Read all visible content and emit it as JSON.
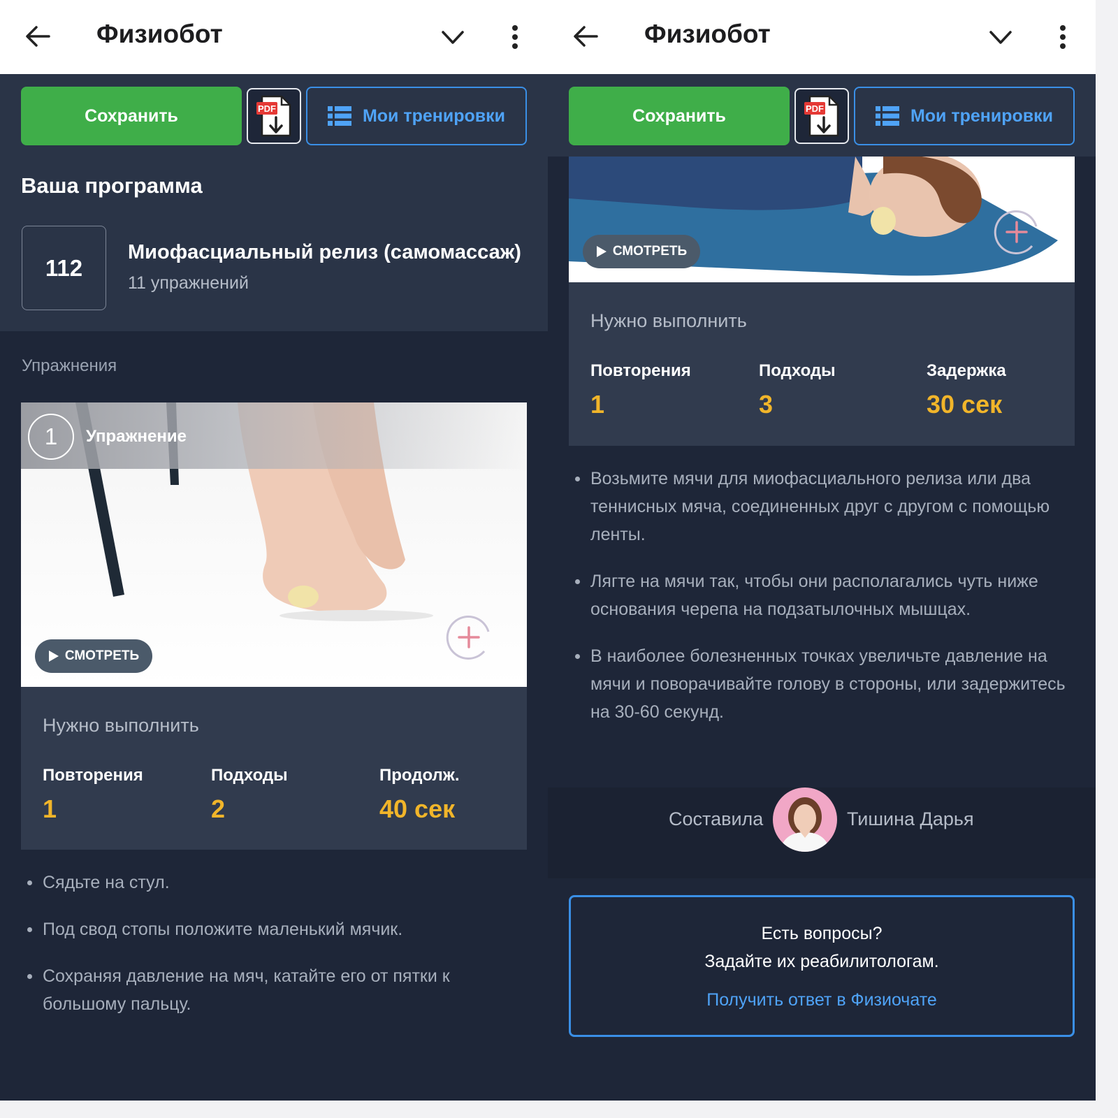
{
  "app": {
    "title": "Физиобот"
  },
  "toolbar": {
    "save_label": "Сохранить",
    "pdf_badge": "PDF",
    "trainings_label": "Мои тренировки"
  },
  "program": {
    "heading": "Ваша программа",
    "number": "112",
    "name": "Миофасциальный релиз (самомассаж)",
    "count": "11 упражнений"
  },
  "exercises": {
    "section_label": "Упражнения",
    "watch_label": "СМОТРЕТЬ",
    "first": {
      "number": "1",
      "label": "Упражнение",
      "todo_title": "Нужно выполнить",
      "stats": [
        {
          "label": "Повторения",
          "value": "1"
        },
        {
          "label": "Подходы",
          "value": "2"
        },
        {
          "label": "Продолж.",
          "value": "40 сек"
        }
      ],
      "steps": [
        "Сядьте на стул.",
        "Под свод стопы положите маленький мячик.",
        "Сохраняя давление на мяч, катайте его от пятки к большому пальцу."
      ]
    },
    "second": {
      "todo_title": "Нужно выполнить",
      "stats": [
        {
          "label": "Повторения",
          "value": "1"
        },
        {
          "label": "Подходы",
          "value": "3"
        },
        {
          "label": "Задержка",
          "value": "30 сек"
        }
      ],
      "steps": [
        "Возьмите мячи для миофасциального релиза или два теннисных мяча, соединенных друг с другом с помощью ленты.",
        "Лягте на мячи так, чтобы они располагались чуть ниже основания черепа на подзатылочных мышцах.",
        "В наиболее болезненных точках увеличьте давление на мячи и поворачивайте голову в стороны, или задержитесь на 30-60 секунд."
      ]
    }
  },
  "author": {
    "by_label": "Составила",
    "name": "Тишина Дарья"
  },
  "questions": {
    "line1": "Есть вопросы?",
    "line2": "Задайте их реабилитологам.",
    "link": "Получить ответ в Физиочате"
  },
  "colors": {
    "background": "#1e2638",
    "panel": "#2a3447",
    "save_green": "#3fae49",
    "accent_blue": "#3a8fe6",
    "value_amber": "#f1b52a"
  },
  "icons": [
    "back-arrow-icon",
    "chevron-down-icon",
    "more-vertical-icon",
    "pdf-download-icon",
    "list-icon",
    "play-icon",
    "add-circle-icon"
  ]
}
